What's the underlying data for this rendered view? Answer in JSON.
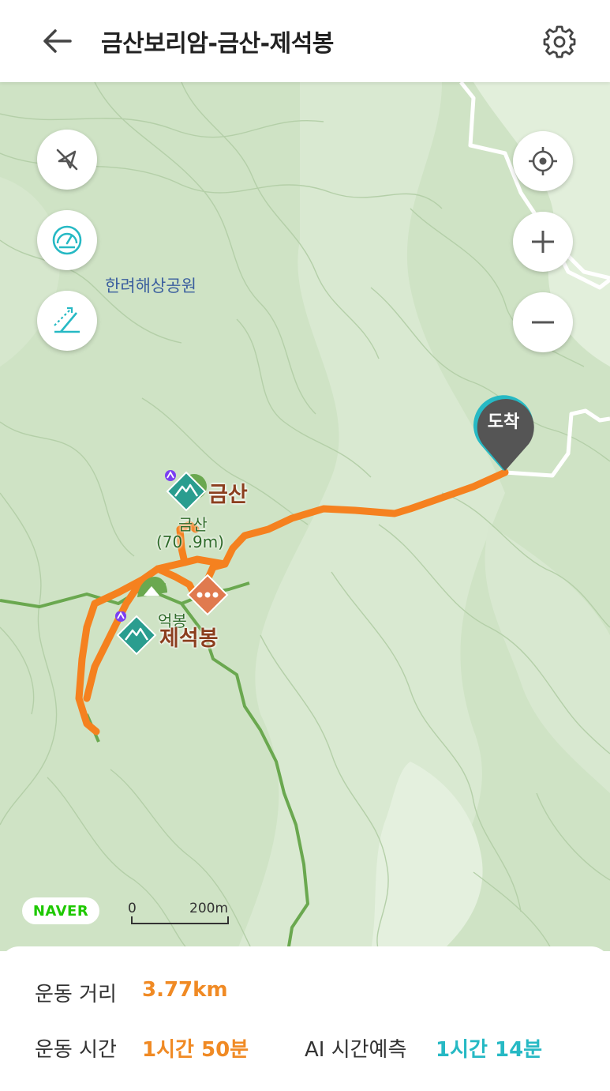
{
  "header": {
    "title": "금산보리암-금산-제석봉"
  },
  "map": {
    "park_label": "한려해상공원",
    "peak_main": {
      "name": "금산",
      "sub_name": "금산",
      "elevation": "(70 .9m)"
    },
    "peak_second": {
      "name": "제석봉",
      "partial_label": "억봉"
    },
    "arrival_label": "도착",
    "scale": {
      "zero": "0",
      "distance": "200m"
    },
    "logo_text": "NAVER",
    "icons": {
      "back": "arrow-left-icon",
      "settings": "gear-icon",
      "track_off": "compass-off-icon",
      "speed": "speedometer-icon",
      "elevation": "elevation-slope-icon",
      "locate": "crosshair-icon",
      "zoom_in": "plus-icon",
      "zoom_out": "minus-icon"
    },
    "colors": {
      "track": "#f5811f",
      "trail": "#6aa84f",
      "marker_teal": "#2a9d8f",
      "marker_orange": "#e07a4f",
      "arrival": "#555555"
    }
  },
  "stats": {
    "distance_label": "운동 거리",
    "distance_value": "3.77km",
    "time_label": "운동 시간",
    "time_value": "1시간 50분",
    "ai_label": "AI 시간예측",
    "ai_value": "1시간 14분"
  }
}
